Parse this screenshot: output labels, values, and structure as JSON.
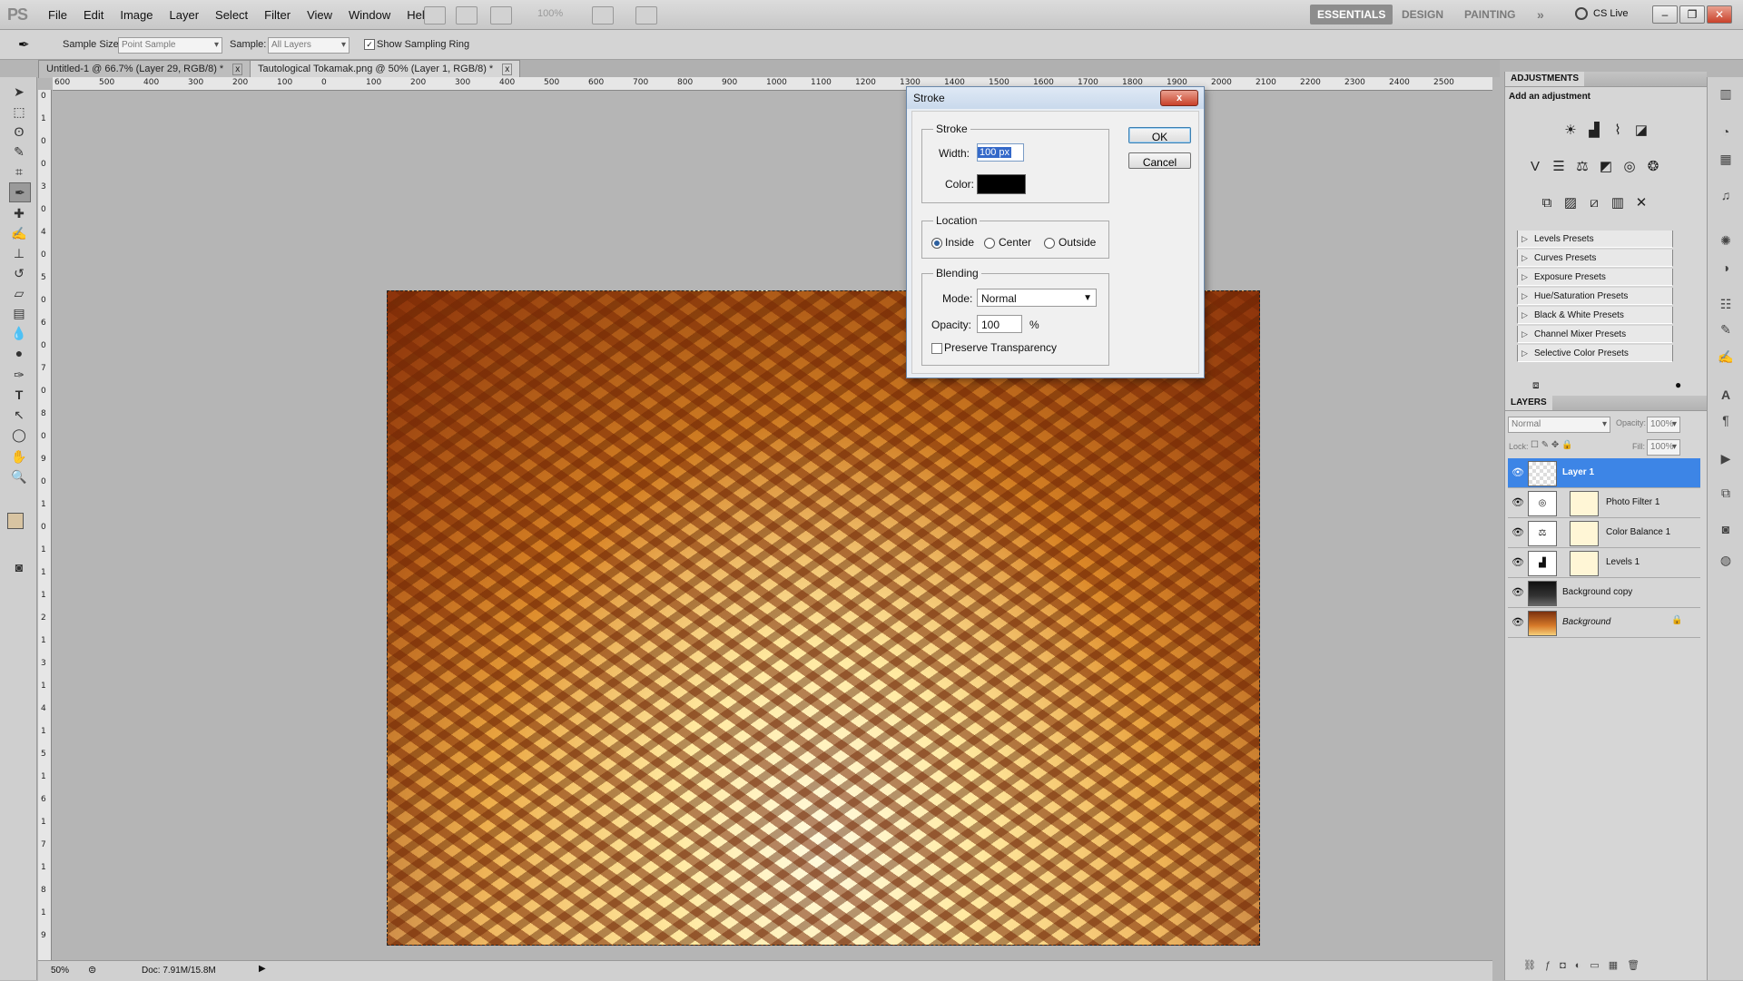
{
  "app": {
    "logo": "PS"
  },
  "menu": [
    "File",
    "Edit",
    "Image",
    "Layer",
    "Select",
    "Filter",
    "View",
    "Window",
    "Help"
  ],
  "zoom_field": "100%",
  "workspaces": [
    "ESSENTIALS",
    "DESIGN",
    "PAINTING"
  ],
  "more_workspaces": "»",
  "cs_live": "CS Live",
  "window_controls": {
    "minimize": "–",
    "restore": "❐",
    "close": "✕"
  },
  "options": {
    "sample_size_label": "Sample Size:",
    "sample_size_value": "Point Sample",
    "sample_label": "Sample:",
    "sample_value": "All Layers",
    "show_ring_label": "Show Sampling Ring",
    "show_ring_checked": true
  },
  "tabs": [
    {
      "label": "Untitled-1 @ 66.7% (Layer 29, RGB/8) *",
      "close": "x"
    },
    {
      "label": "Tautological Tokamak.png @ 50% (Layer 1, RGB/8) *",
      "close": "x"
    }
  ],
  "ruler_h": [
    "600",
    "500",
    "400",
    "300",
    "200",
    "100",
    "0",
    "100",
    "200",
    "300",
    "400",
    "500",
    "600",
    "700",
    "800",
    "900",
    "1000",
    "1100",
    "1200",
    "1300",
    "1400",
    "1500",
    "1600",
    "1700",
    "1800",
    "1900",
    "2000",
    "2100",
    "2200",
    "2300",
    "2400",
    "2500"
  ],
  "ruler_v": [
    "0",
    "1",
    "0",
    "0",
    "3",
    "0",
    "4",
    "0",
    "5",
    "0",
    "6",
    "0",
    "7",
    "0",
    "8",
    "0",
    "9",
    "0",
    "1",
    "0",
    "1",
    "1",
    "1",
    "2",
    "1",
    "3",
    "1",
    "4",
    "1",
    "5",
    "1",
    "6",
    "1",
    "7",
    "1",
    "8",
    "1",
    "9"
  ],
  "status": {
    "zoom": "50%",
    "doc": "Doc: 7.91M/15.8M"
  },
  "adjustments": {
    "panel_title": "ADJUSTMENTS",
    "subtitle": "Add an adjustment",
    "presets": [
      "Levels Presets",
      "Curves Presets",
      "Exposure Presets",
      "Hue/Saturation Presets",
      "Black & White Presets",
      "Channel Mixer Presets",
      "Selective Color Presets"
    ]
  },
  "layers": {
    "panel_title": "LAYERS",
    "blend_mode": "Normal",
    "opacity_label": "Opacity:",
    "opacity_value": "100%",
    "lock_label": "Lock:",
    "fill_label": "Fill:",
    "fill_value": "100%",
    "items": [
      {
        "name": "Layer 1",
        "selected": true
      },
      {
        "name": "Photo Filter 1",
        "selected": false
      },
      {
        "name": "Color Balance 1",
        "selected": false
      },
      {
        "name": "Levels 1",
        "selected": false
      },
      {
        "name": "Background copy",
        "selected": false
      },
      {
        "name": "Background",
        "selected": false
      }
    ]
  },
  "dialog": {
    "title": "Stroke",
    "close": "x",
    "stroke_group": "Stroke",
    "width_label": "Width:",
    "width_value": "100 px",
    "color_label": "Color:",
    "color_value": "#000000",
    "location_group": "Location",
    "location_options": [
      "Inside",
      "Center",
      "Outside"
    ],
    "location_selected": "Inside",
    "blending_group": "Blending",
    "mode_label": "Mode:",
    "mode_value": "Normal",
    "opacity_label": "Opacity:",
    "opacity_value": "100",
    "opacity_unit": "%",
    "preserve_label": "Preserve Transparency",
    "preserve_checked": false,
    "ok_label": "OK",
    "cancel_label": "Cancel"
  }
}
